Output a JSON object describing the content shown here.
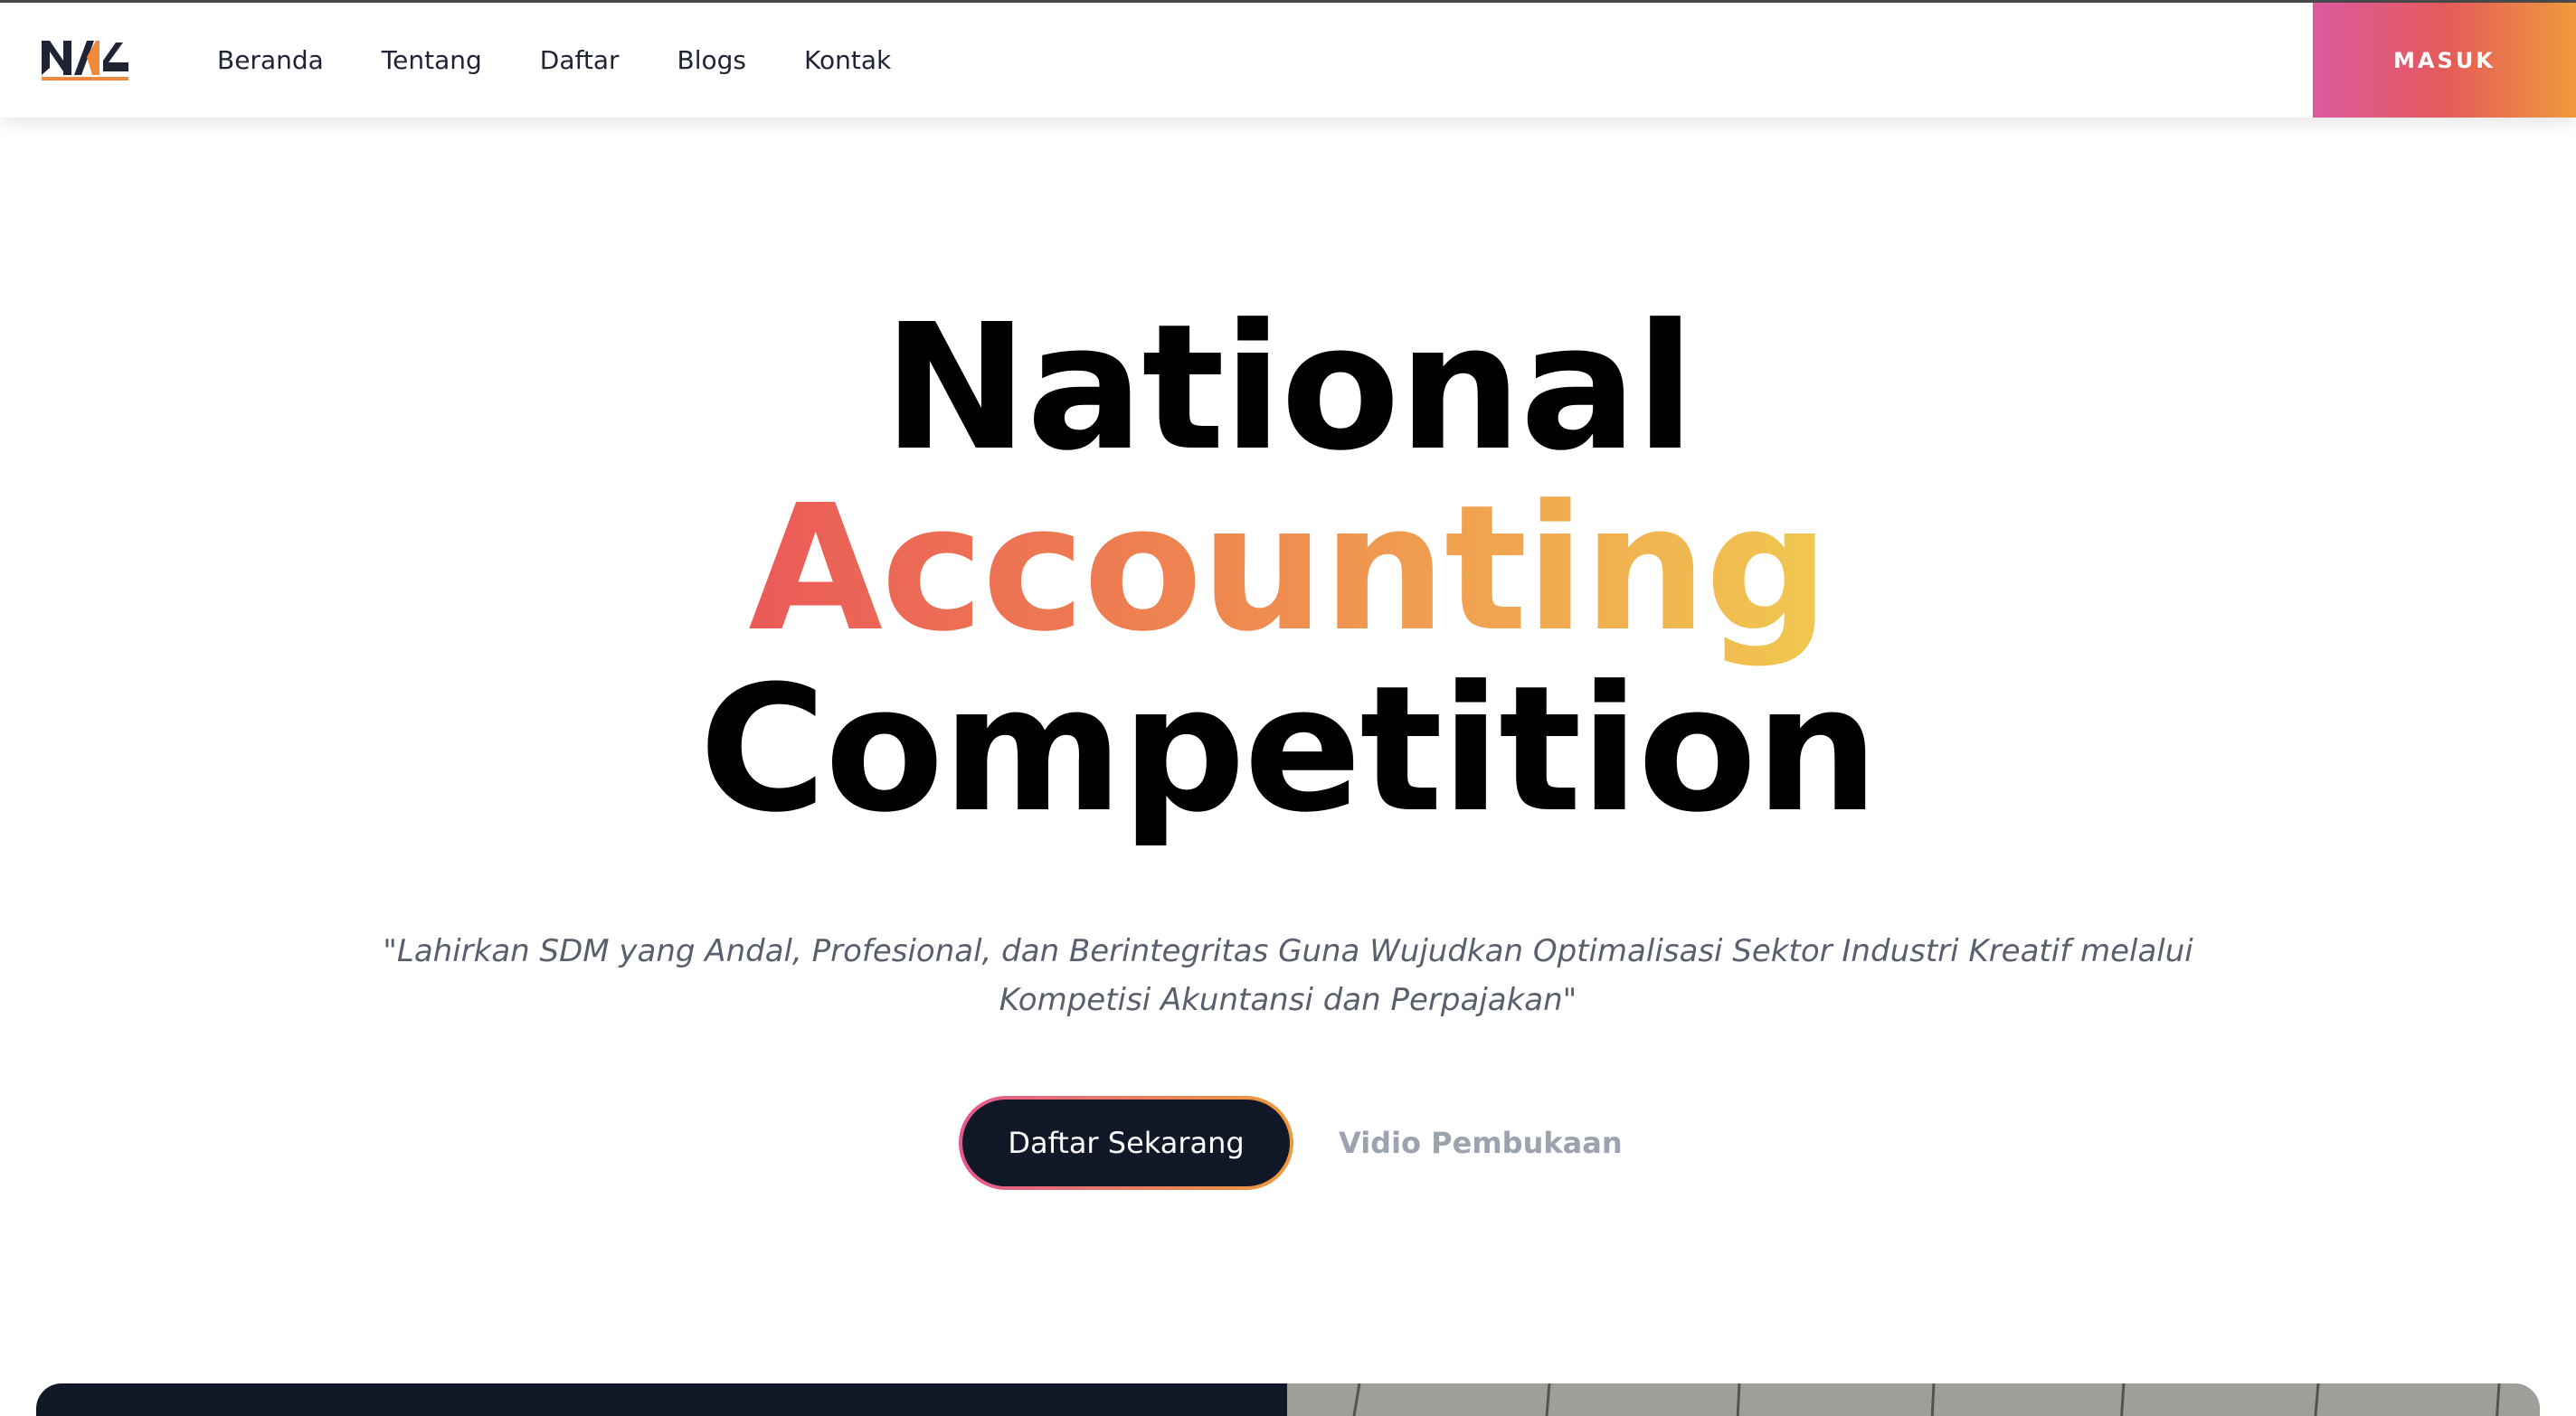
{
  "nav": {
    "logo_text": "NAC",
    "links": [
      "Beranda",
      "Tentang",
      "Daftar",
      "Blogs",
      "Kontak"
    ],
    "login_label": "MASUK"
  },
  "hero": {
    "title_line1": "National",
    "title_line2": "Accounting",
    "title_line3": "Competition",
    "tagline": "\"Lahirkan SDM yang Andal, Profesional, dan Berintegritas Guna Wujudkan Optimalisasi Sektor Industri Kreatif melalui Kompetisi Akuntansi dan Perpajakan\"",
    "primary_cta": "Daftar Sekarang",
    "secondary_cta": "Vidio Pembukaan"
  },
  "colors": {
    "login_gradient": [
      "#dc5aa0",
      "#e45a5a",
      "#ef9a3c"
    ],
    "title_gradient": [
      "#ea5a58",
      "#ef8950",
      "#f0c850"
    ],
    "cta_bg": "#111827"
  }
}
